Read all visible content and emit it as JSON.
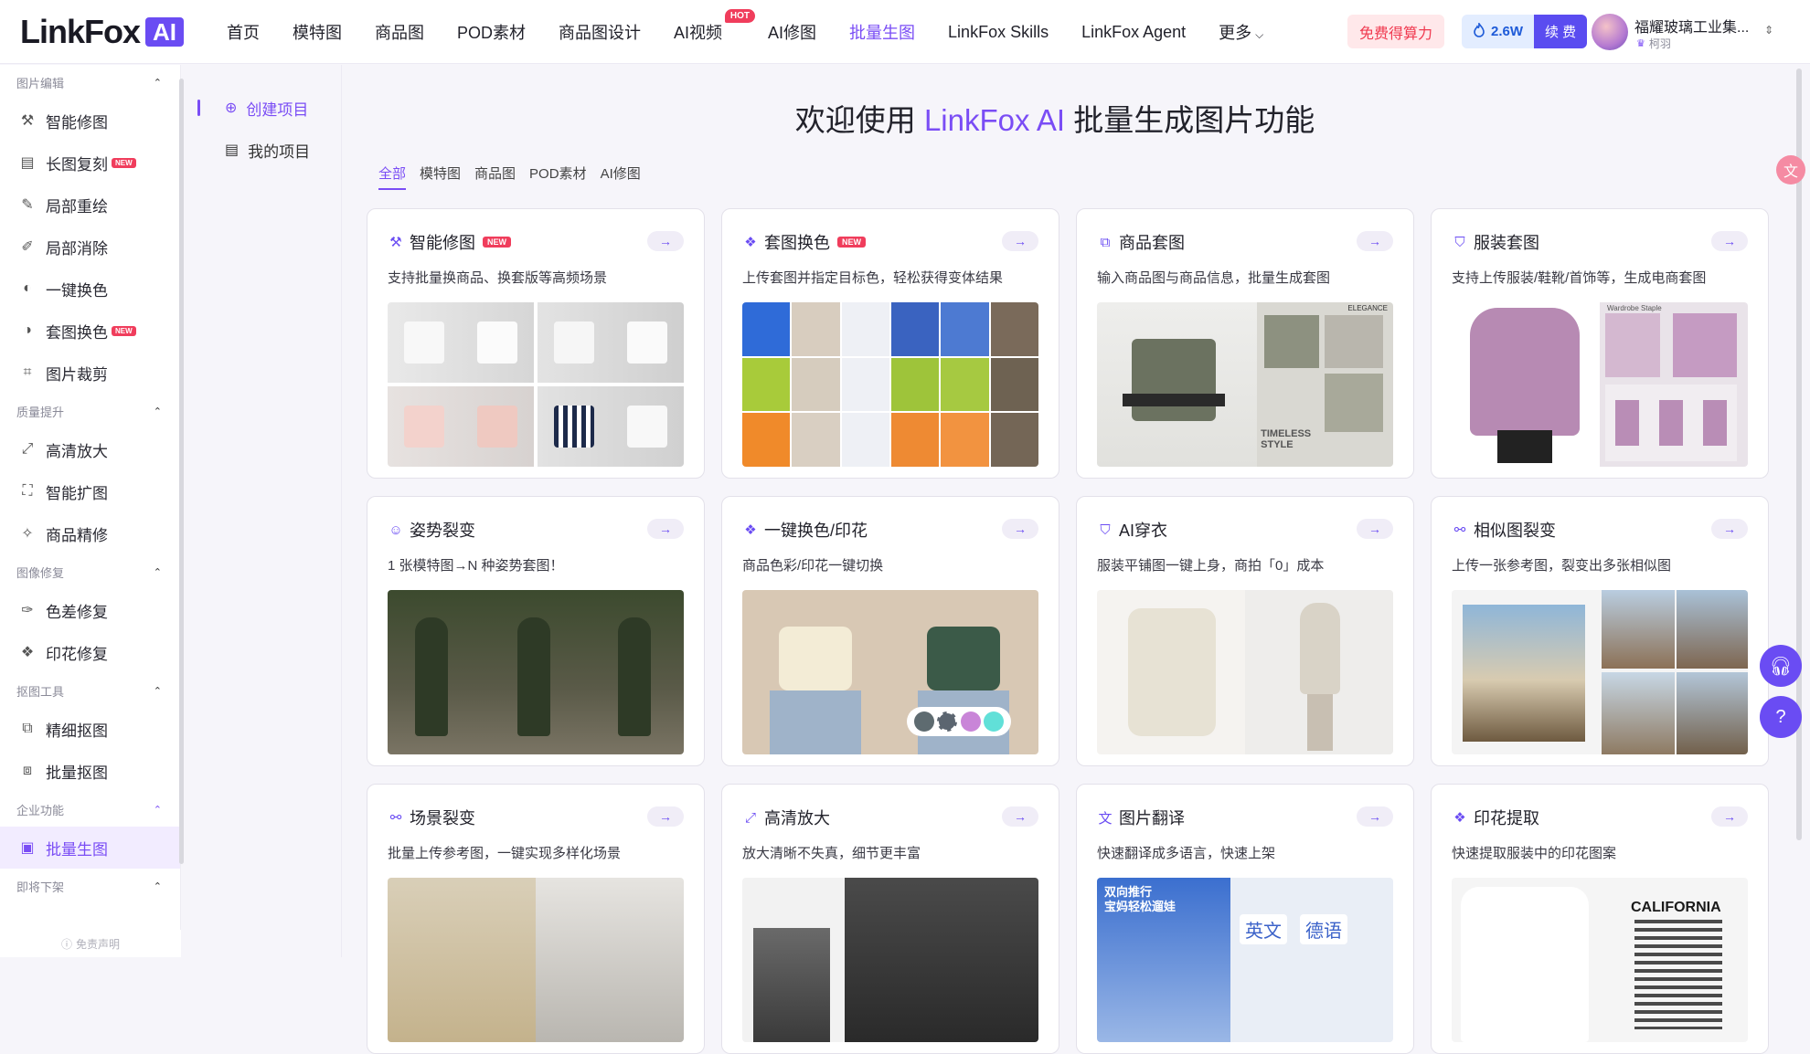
{
  "logo": {
    "text": "LinkFox",
    "badge": "AI"
  },
  "nav": {
    "items": [
      "首页",
      "模特图",
      "商品图",
      "POD素材",
      "商品图设计",
      "AI视频",
      "AI修图",
      "批量生图",
      "LinkFox Skills",
      "LinkFox Agent",
      "更多"
    ],
    "hot_label": "HOT",
    "active": "批量生图"
  },
  "header": {
    "free_button": "免费得算力",
    "credit_value": "2.6W",
    "renew_button": "续 费",
    "user_name": "福耀玻璃工业集...",
    "user_sub": "柯羽"
  },
  "sidebar": {
    "groups": [
      {
        "title": "图片编辑",
        "items": [
          {
            "label": "智能修图",
            "new": false
          },
          {
            "label": "长图复刻",
            "new": true
          },
          {
            "label": "局部重绘",
            "new": false
          },
          {
            "label": "局部消除",
            "new": false
          },
          {
            "label": "一键换色",
            "new": false
          },
          {
            "label": "套图换色",
            "new": true
          },
          {
            "label": "图片裁剪",
            "new": false
          }
        ]
      },
      {
        "title": "质量提升",
        "items": [
          {
            "label": "高清放大",
            "new": false
          },
          {
            "label": "智能扩图",
            "new": false
          },
          {
            "label": "商品精修",
            "new": false
          }
        ]
      },
      {
        "title": "图像修复",
        "items": [
          {
            "label": "色差修复",
            "new": false
          },
          {
            "label": "印花修复",
            "new": false
          }
        ]
      },
      {
        "title": "抠图工具",
        "items": [
          {
            "label": "精细抠图",
            "new": false
          },
          {
            "label": "批量抠图",
            "new": false
          }
        ]
      },
      {
        "title": "企业功能",
        "items": [
          {
            "label": "批量生图",
            "new": false,
            "active": true
          }
        ]
      },
      {
        "title": "即将下架",
        "items": []
      }
    ],
    "new_label": "NEW",
    "footer": "免责声明"
  },
  "subnav": {
    "create": "创建项目",
    "mine": "我的项目"
  },
  "main": {
    "welcome_prefix": "欢迎使用 ",
    "welcome_brand": "LinkFox AI",
    "welcome_suffix": " 批量生成图片功能",
    "tabs": [
      "全部",
      "模特图",
      "商品图",
      "POD素材",
      "AI修图"
    ],
    "active_tab": "全部"
  },
  "cards": [
    {
      "title": "智能修图",
      "new": true,
      "desc": "支持批量换商品、换套版等高频场景",
      "icon": "magic-wand-icon"
    },
    {
      "title": "套图换色",
      "new": true,
      "desc": "上传套图并指定目标色，轻松获得变体结果",
      "icon": "sparkle-icon"
    },
    {
      "title": "商品套图",
      "new": false,
      "desc": "输入商品图与商品信息，批量生成套图",
      "icon": "image-set-icon"
    },
    {
      "title": "服装套图",
      "new": false,
      "desc": "支持上传服装/鞋靴/首饰等，生成电商套图",
      "icon": "clothing-icon"
    },
    {
      "title": "姿势裂变",
      "new": false,
      "desc": "1 张模特图→N 种姿势套图！",
      "icon": "pose-icon"
    },
    {
      "title": "一键换色/印花",
      "new": false,
      "desc": "商品色彩/印花一键切换",
      "icon": "sparkle-icon"
    },
    {
      "title": "AI穿衣",
      "new": false,
      "desc": "服装平铺图一键上身，商拍「0」成本",
      "icon": "shirt-icon"
    },
    {
      "title": "相似图裂变",
      "new": false,
      "desc": "上传一张参考图，裂变出多张相似图",
      "icon": "share-icon"
    },
    {
      "title": "场景裂变",
      "new": false,
      "desc": "批量上传参考图，一键实现多样化场景",
      "icon": "scene-icon"
    },
    {
      "title": "高清放大",
      "new": false,
      "desc": "放大清晰不失真，细节更丰富",
      "icon": "upscale-icon"
    },
    {
      "title": "图片翻译",
      "new": false,
      "desc": "快速翻译成多语言，快速上架",
      "icon": "translate-icon"
    },
    {
      "title": "印花提取",
      "new": false,
      "desc": "快速提取服装中的印花图案",
      "icon": "pattern-icon"
    }
  ],
  "card_image_text": {
    "elegance": "ELEGANCE",
    "timeless": "TIMELESS STYLE",
    "wardrobe": "Wardrobe Staple",
    "translate_cn1": "双向推行",
    "translate_cn2": "宝妈轻松遛娃",
    "translate_en": "英文",
    "translate_de": "德语",
    "california": "CALIFORNIA"
  },
  "colors": {
    "accent": "#7a4df5",
    "hot": "#f03d5c",
    "brand_badge": "#6a4cf3"
  }
}
